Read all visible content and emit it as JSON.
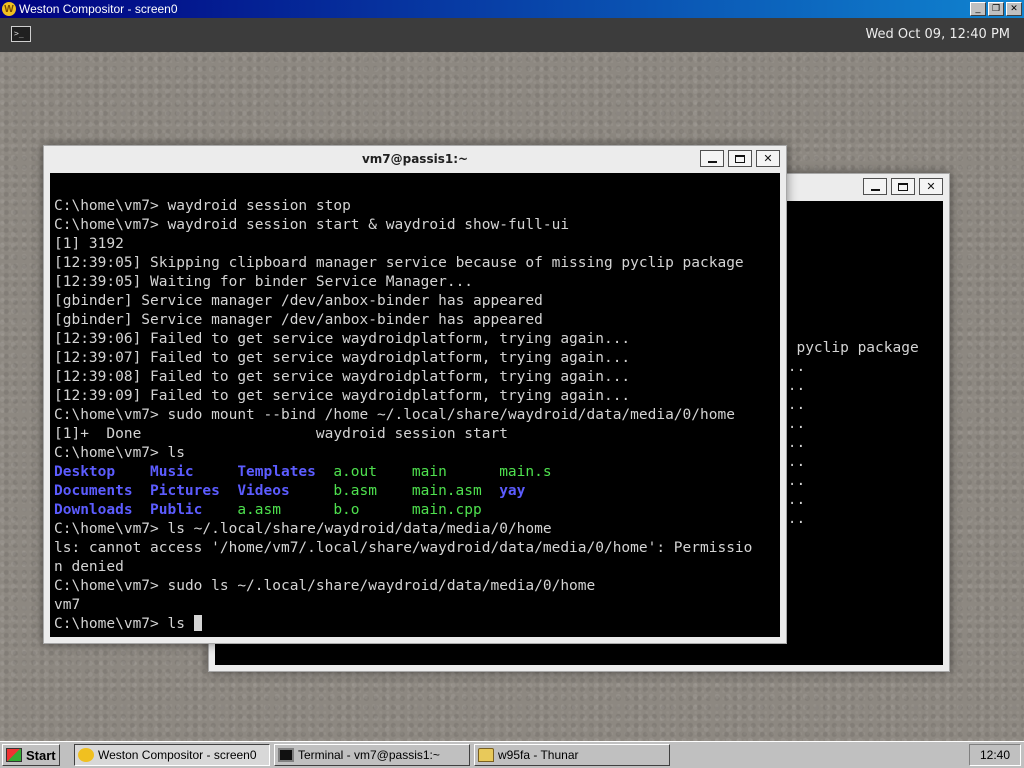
{
  "host_window": {
    "title": "Weston Compositor - screen0",
    "controls": {
      "minimize": "_",
      "restore": "❐",
      "close": "✕"
    }
  },
  "panel": {
    "launcher_icon": "terminal-icon",
    "clock": "Wed Oct 09, 12:40 PM"
  },
  "back_window": {
    "title": "",
    "buttons": {
      "minimize": "",
      "maximize": "",
      "close": "✕"
    },
    "visible_lines": [
      "g pyclip package",
      "...",
      "...",
      "...",
      "...",
      "...",
      "...",
      "...",
      "...",
      "..."
    ]
  },
  "front_window": {
    "title": "vm7@passis1:~",
    "buttons": {
      "minimize": "",
      "maximize": "",
      "close": "✕"
    },
    "terminal": {
      "lines": [
        "C:\\home\\vm7> waydroid session stop",
        "C:\\home\\vm7> waydroid session start & waydroid show-full-ui",
        "[1] 3192",
        "[12:39:05] Skipping clipboard manager service because of missing pyclip package",
        "[12:39:05] Waiting for binder Service Manager...",
        "[gbinder] Service manager /dev/anbox-binder has appeared",
        "[gbinder] Service manager /dev/anbox-binder has appeared",
        "[12:39:06] Failed to get service waydroidplatform, trying again...",
        "[12:39:07] Failed to get service waydroidplatform, trying again...",
        "[12:39:08] Failed to get service waydroidplatform, trying again...",
        "[12:39:09] Failed to get service waydroidplatform, trying again...",
        "C:\\home\\vm7> sudo mount --bind /home ~/.local/share/waydroid/data/media/0/home",
        "[1]+  Done                    waydroid session start",
        "C:\\home\\vm7> ls"
      ],
      "ls_listing": [
        [
          {
            "text": "Desktop",
            "color": "blue"
          },
          {
            "text": "Music",
            "color": "blue"
          },
          {
            "text": "Templates",
            "color": "blue"
          },
          {
            "text": "a.out",
            "color": "green"
          },
          {
            "text": "main",
            "color": "green"
          },
          {
            "text": "main.s",
            "color": "green"
          }
        ],
        [
          {
            "text": "Documents",
            "color": "blue"
          },
          {
            "text": "Pictures",
            "color": "blue"
          },
          {
            "text": "Videos",
            "color": "blue"
          },
          {
            "text": "b.asm",
            "color": "green"
          },
          {
            "text": "main.asm",
            "color": "green"
          },
          {
            "text": "yay",
            "color": "blue"
          }
        ],
        [
          {
            "text": "Downloads",
            "color": "blue"
          },
          {
            "text": "Public",
            "color": "blue"
          },
          {
            "text": "a.asm",
            "color": "green"
          },
          {
            "text": "b.o",
            "color": "green"
          },
          {
            "text": "main.cpp",
            "color": "green"
          },
          {
            "text": "",
            "color": "green"
          }
        ]
      ],
      "lines_after": [
        "C:\\home\\vm7> ls ~/.local/share/waydroid/data/media/0/home",
        "ls: cannot access '/home/vm7/.local/share/waydroid/data/media/0/home': Permissio",
        "n denied",
        "C:\\home\\vm7> sudo ls ~/.local/share/waydroid/data/media/0/home",
        "vm7"
      ],
      "prompt": "C:\\home\\vm7> ",
      "current_input": "ls"
    }
  },
  "taskbar": {
    "start_label": "Start",
    "items": [
      {
        "label": "Weston Compositor - screen0",
        "icon": "weston-icon",
        "active": true
      },
      {
        "label": "Terminal - vm7@passis1:~",
        "icon": "terminal-icon",
        "active": false
      },
      {
        "label": "w95fa - Thunar",
        "icon": "folder-icon",
        "active": false
      }
    ],
    "tray_clock": "12:40"
  }
}
